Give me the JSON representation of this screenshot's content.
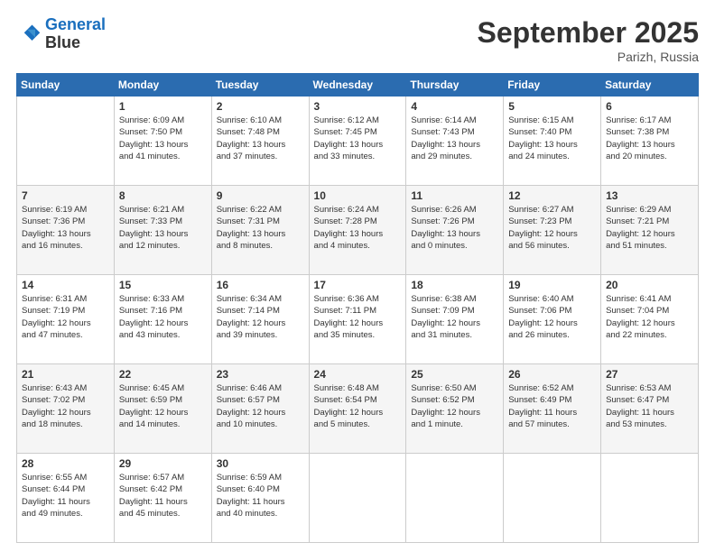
{
  "logo": {
    "line1": "General",
    "line2": "Blue"
  },
  "title": "September 2025",
  "location": "Parizh, Russia",
  "weekdays": [
    "Sunday",
    "Monday",
    "Tuesday",
    "Wednesday",
    "Thursday",
    "Friday",
    "Saturday"
  ],
  "weeks": [
    [
      {
        "day": null,
        "info": null
      },
      {
        "day": "1",
        "info": "Sunrise: 6:09 AM\nSunset: 7:50 PM\nDaylight: 13 hours\nand 41 minutes."
      },
      {
        "day": "2",
        "info": "Sunrise: 6:10 AM\nSunset: 7:48 PM\nDaylight: 13 hours\nand 37 minutes."
      },
      {
        "day": "3",
        "info": "Sunrise: 6:12 AM\nSunset: 7:45 PM\nDaylight: 13 hours\nand 33 minutes."
      },
      {
        "day": "4",
        "info": "Sunrise: 6:14 AM\nSunset: 7:43 PM\nDaylight: 13 hours\nand 29 minutes."
      },
      {
        "day": "5",
        "info": "Sunrise: 6:15 AM\nSunset: 7:40 PM\nDaylight: 13 hours\nand 24 minutes."
      },
      {
        "day": "6",
        "info": "Sunrise: 6:17 AM\nSunset: 7:38 PM\nDaylight: 13 hours\nand 20 minutes."
      }
    ],
    [
      {
        "day": "7",
        "info": "Sunrise: 6:19 AM\nSunset: 7:36 PM\nDaylight: 13 hours\nand 16 minutes."
      },
      {
        "day": "8",
        "info": "Sunrise: 6:21 AM\nSunset: 7:33 PM\nDaylight: 13 hours\nand 12 minutes."
      },
      {
        "day": "9",
        "info": "Sunrise: 6:22 AM\nSunset: 7:31 PM\nDaylight: 13 hours\nand 8 minutes."
      },
      {
        "day": "10",
        "info": "Sunrise: 6:24 AM\nSunset: 7:28 PM\nDaylight: 13 hours\nand 4 minutes."
      },
      {
        "day": "11",
        "info": "Sunrise: 6:26 AM\nSunset: 7:26 PM\nDaylight: 13 hours\nand 0 minutes."
      },
      {
        "day": "12",
        "info": "Sunrise: 6:27 AM\nSunset: 7:23 PM\nDaylight: 12 hours\nand 56 minutes."
      },
      {
        "day": "13",
        "info": "Sunrise: 6:29 AM\nSunset: 7:21 PM\nDaylight: 12 hours\nand 51 minutes."
      }
    ],
    [
      {
        "day": "14",
        "info": "Sunrise: 6:31 AM\nSunset: 7:19 PM\nDaylight: 12 hours\nand 47 minutes."
      },
      {
        "day": "15",
        "info": "Sunrise: 6:33 AM\nSunset: 7:16 PM\nDaylight: 12 hours\nand 43 minutes."
      },
      {
        "day": "16",
        "info": "Sunrise: 6:34 AM\nSunset: 7:14 PM\nDaylight: 12 hours\nand 39 minutes."
      },
      {
        "day": "17",
        "info": "Sunrise: 6:36 AM\nSunset: 7:11 PM\nDaylight: 12 hours\nand 35 minutes."
      },
      {
        "day": "18",
        "info": "Sunrise: 6:38 AM\nSunset: 7:09 PM\nDaylight: 12 hours\nand 31 minutes."
      },
      {
        "day": "19",
        "info": "Sunrise: 6:40 AM\nSunset: 7:06 PM\nDaylight: 12 hours\nand 26 minutes."
      },
      {
        "day": "20",
        "info": "Sunrise: 6:41 AM\nSunset: 7:04 PM\nDaylight: 12 hours\nand 22 minutes."
      }
    ],
    [
      {
        "day": "21",
        "info": "Sunrise: 6:43 AM\nSunset: 7:02 PM\nDaylight: 12 hours\nand 18 minutes."
      },
      {
        "day": "22",
        "info": "Sunrise: 6:45 AM\nSunset: 6:59 PM\nDaylight: 12 hours\nand 14 minutes."
      },
      {
        "day": "23",
        "info": "Sunrise: 6:46 AM\nSunset: 6:57 PM\nDaylight: 12 hours\nand 10 minutes."
      },
      {
        "day": "24",
        "info": "Sunrise: 6:48 AM\nSunset: 6:54 PM\nDaylight: 12 hours\nand 5 minutes."
      },
      {
        "day": "25",
        "info": "Sunrise: 6:50 AM\nSunset: 6:52 PM\nDaylight: 12 hours\nand 1 minute."
      },
      {
        "day": "26",
        "info": "Sunrise: 6:52 AM\nSunset: 6:49 PM\nDaylight: 11 hours\nand 57 minutes."
      },
      {
        "day": "27",
        "info": "Sunrise: 6:53 AM\nSunset: 6:47 PM\nDaylight: 11 hours\nand 53 minutes."
      }
    ],
    [
      {
        "day": "28",
        "info": "Sunrise: 6:55 AM\nSunset: 6:44 PM\nDaylight: 11 hours\nand 49 minutes."
      },
      {
        "day": "29",
        "info": "Sunrise: 6:57 AM\nSunset: 6:42 PM\nDaylight: 11 hours\nand 45 minutes."
      },
      {
        "day": "30",
        "info": "Sunrise: 6:59 AM\nSunset: 6:40 PM\nDaylight: 11 hours\nand 40 minutes."
      },
      {
        "day": null,
        "info": null
      },
      {
        "day": null,
        "info": null
      },
      {
        "day": null,
        "info": null
      },
      {
        "day": null,
        "info": null
      }
    ]
  ]
}
